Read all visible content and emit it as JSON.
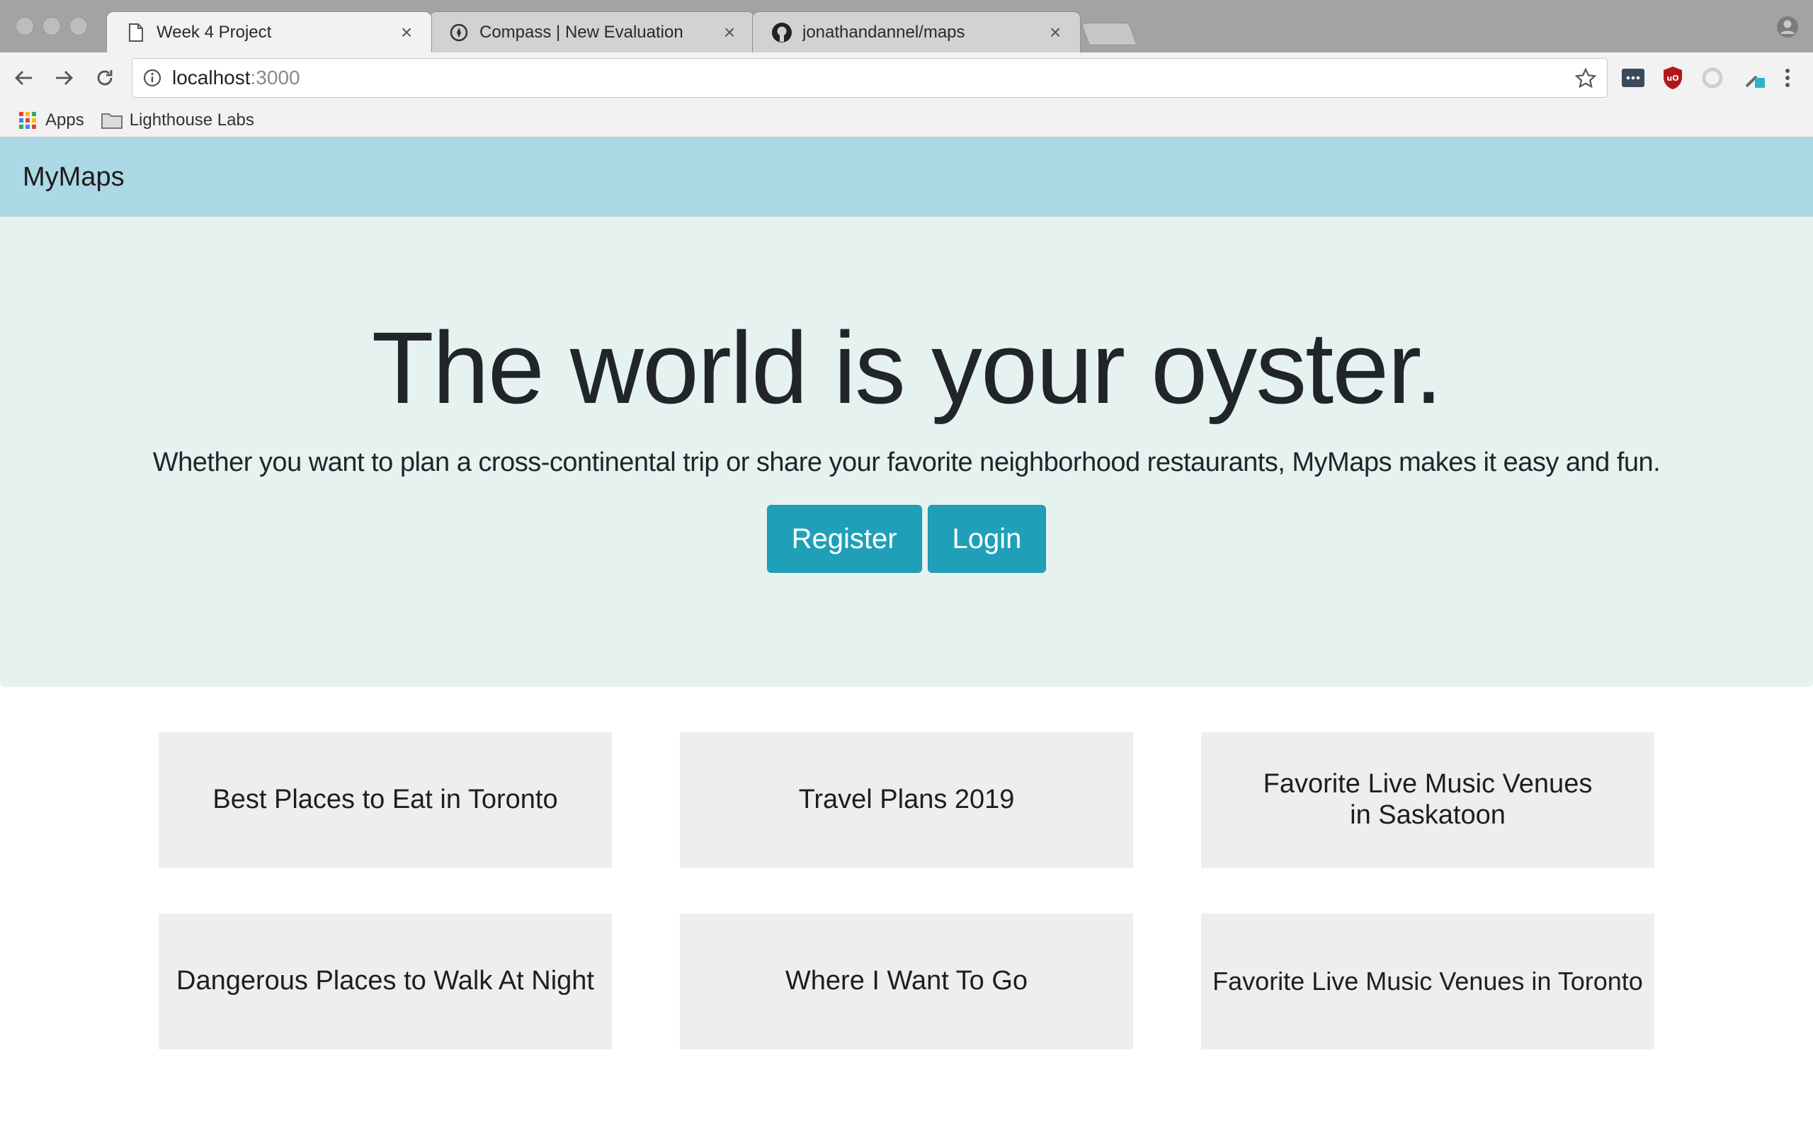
{
  "browser": {
    "tabs": [
      {
        "title": "Week 4 Project",
        "icon": "document-icon",
        "active": true
      },
      {
        "title": "Compass | New Evaluation",
        "icon": "compass-icon",
        "active": false
      },
      {
        "title": "jonathandannel/maps",
        "icon": "github-icon",
        "active": false
      }
    ],
    "address": {
      "host": "localhost",
      "port": ":3000"
    },
    "bookmarks": [
      {
        "label": "Apps",
        "icon": "apps-grid-icon"
      },
      {
        "label": "Lighthouse Labs",
        "icon": "folder-icon"
      }
    ],
    "colors": {
      "chrome_bg": "#a3a3a3",
      "toolbar_bg": "#f2f2f2"
    }
  },
  "site": {
    "brand": "MyMaps",
    "colors": {
      "navbar": "#add8e6",
      "hero": "#e6f2ef",
      "button": "#20a0b8",
      "card": "#eeeeee"
    }
  },
  "hero": {
    "title": "The world is your oyster.",
    "subtitle": "Whether you want to plan a cross-continental trip or share your favorite neighborhood restaurants, MyMaps makes it easy and fun.",
    "register_label": "Register",
    "login_label": "Login"
  },
  "maps": [
    {
      "title": "Best Places to Eat in Toronto"
    },
    {
      "title": "Travel Plans 2019"
    },
    {
      "title": "Favorite Live Music Venues in Saskatoon"
    },
    {
      "title": "Dangerous Places to Walk At Night"
    },
    {
      "title": "Where I Want To Go"
    },
    {
      "title": "Favorite Live Music Venues in Toronto"
    }
  ]
}
